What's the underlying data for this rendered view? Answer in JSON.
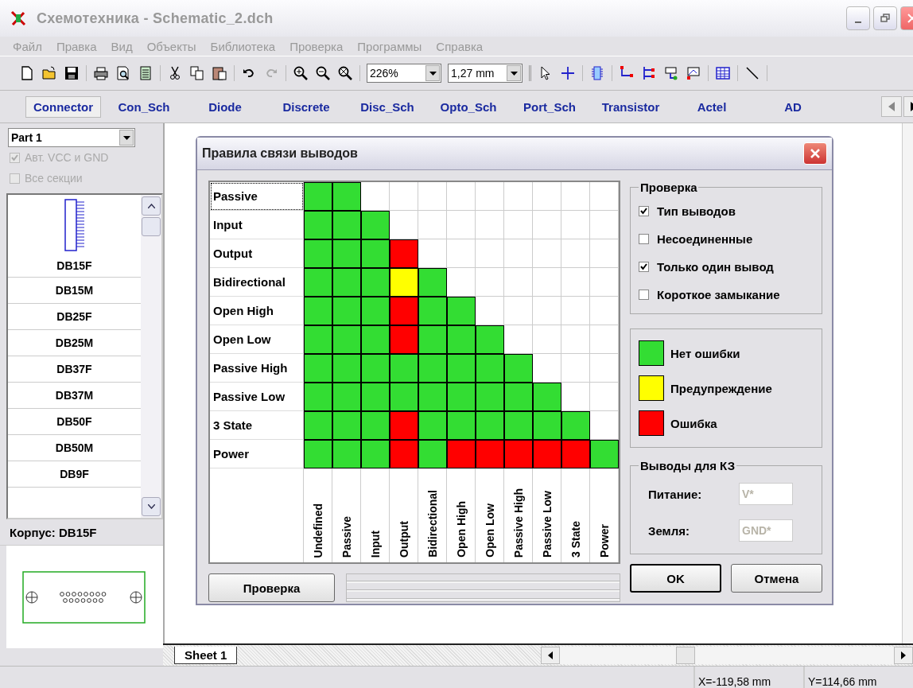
{
  "window": {
    "title": "Схемотехника - Schematic_2.dch"
  },
  "menu": [
    "Файл",
    "Правка",
    "Вид",
    "Объекты",
    "Библиотека",
    "Проверка",
    "Программы",
    "Справка"
  ],
  "toolbar": {
    "zoom": "226%",
    "grid": "1,27 mm"
  },
  "library_tabs": [
    {
      "label": "Connector",
      "selected": true
    },
    {
      "label": "Con_Sch",
      "selected": false
    },
    {
      "label": "Diode",
      "selected": false
    },
    {
      "label": "Discrete",
      "selected": false
    },
    {
      "label": "Disc_Sch",
      "selected": false
    },
    {
      "label": "Opto_Sch",
      "selected": false
    },
    {
      "label": "Port_Sch",
      "selected": false
    },
    {
      "label": "Transistor",
      "selected": false
    },
    {
      "label": "Actel",
      "selected": false
    },
    {
      "label": "AD",
      "selected": false
    }
  ],
  "sidebar": {
    "part": "Part 1",
    "options": [
      {
        "label": "Авт. VCC и GND",
        "checked": true,
        "disabled": true
      },
      {
        "label": "Все секции",
        "checked": false,
        "disabled": true
      }
    ],
    "components": [
      {
        "name": "DB15F",
        "selected": true
      },
      {
        "name": "DB15M",
        "selected": false
      },
      {
        "name": "DB25F",
        "selected": false
      },
      {
        "name": "DB25M",
        "selected": false
      },
      {
        "name": "DB37F",
        "selected": false
      },
      {
        "name": "DB37M",
        "selected": false
      },
      {
        "name": "DB50F",
        "selected": false
      },
      {
        "name": "DB50M",
        "selected": false
      },
      {
        "name": "DB9F",
        "selected": false
      }
    ],
    "package": "Корпус: DB15F"
  },
  "sheet_tabs": [
    {
      "label": "Sheet 1",
      "selected": true
    }
  ],
  "status_bar": {
    "x": "X=-119,58 mm",
    "y": "Y=114,66 mm"
  },
  "dialog": {
    "title": "Правила связи выводов",
    "rows": [
      {
        "label": "Passive",
        "focused": true,
        "cells": [
          {
            "color": "#33dd33"
          },
          {
            "color": "#33dd33"
          }
        ]
      },
      {
        "label": "Input",
        "focused": false,
        "cells": [
          {
            "color": "#33dd33"
          },
          {
            "color": "#33dd33"
          },
          {
            "color": "#33dd33"
          }
        ]
      },
      {
        "label": "Output",
        "focused": false,
        "cells": [
          {
            "color": "#33dd33"
          },
          {
            "color": "#33dd33"
          },
          {
            "color": "#33dd33"
          },
          {
            "color": "#ff0000"
          }
        ]
      },
      {
        "label": "Bidirectional",
        "focused": false,
        "cells": [
          {
            "color": "#33dd33"
          },
          {
            "color": "#33dd33"
          },
          {
            "color": "#33dd33"
          },
          {
            "color": "#ffff00"
          },
          {
            "color": "#33dd33"
          }
        ]
      },
      {
        "label": "Open High",
        "focused": false,
        "cells": [
          {
            "color": "#33dd33"
          },
          {
            "color": "#33dd33"
          },
          {
            "color": "#33dd33"
          },
          {
            "color": "#ff0000"
          },
          {
            "color": "#33dd33"
          },
          {
            "color": "#33dd33"
          }
        ]
      },
      {
        "label": "Open Low",
        "focused": false,
        "cells": [
          {
            "color": "#33dd33"
          },
          {
            "color": "#33dd33"
          },
          {
            "color": "#33dd33"
          },
          {
            "color": "#ff0000"
          },
          {
            "color": "#33dd33"
          },
          {
            "color": "#33dd33"
          },
          {
            "color": "#33dd33"
          }
        ]
      },
      {
        "label": "Passive High",
        "focused": false,
        "cells": [
          {
            "color": "#33dd33"
          },
          {
            "color": "#33dd33"
          },
          {
            "color": "#33dd33"
          },
          {
            "color": "#33dd33"
          },
          {
            "color": "#33dd33"
          },
          {
            "color": "#33dd33"
          },
          {
            "color": "#33dd33"
          },
          {
            "color": "#33dd33"
          }
        ]
      },
      {
        "label": "Passive Low",
        "focused": false,
        "cells": [
          {
            "color": "#33dd33"
          },
          {
            "color": "#33dd33"
          },
          {
            "color": "#33dd33"
          },
          {
            "color": "#33dd33"
          },
          {
            "color": "#33dd33"
          },
          {
            "color": "#33dd33"
          },
          {
            "color": "#33dd33"
          },
          {
            "color": "#33dd33"
          },
          {
            "color": "#33dd33"
          }
        ]
      },
      {
        "label": "3 State",
        "focused": false,
        "cells": [
          {
            "color": "#33dd33"
          },
          {
            "color": "#33dd33"
          },
          {
            "color": "#33dd33"
          },
          {
            "color": "#ff0000"
          },
          {
            "color": "#33dd33"
          },
          {
            "color": "#33dd33"
          },
          {
            "color": "#33dd33"
          },
          {
            "color": "#33dd33"
          },
          {
            "color": "#33dd33"
          },
          {
            "color": "#33dd33"
          }
        ]
      },
      {
        "label": "Power",
        "focused": false,
        "cells": [
          {
            "color": "#33dd33"
          },
          {
            "color": "#33dd33"
          },
          {
            "color": "#33dd33"
          },
          {
            "color": "#ff0000"
          },
          {
            "color": "#33dd33"
          },
          {
            "color": "#ff0000"
          },
          {
            "color": "#ff0000"
          },
          {
            "color": "#ff0000"
          },
          {
            "color": "#ff0000"
          },
          {
            "color": "#ff0000"
          },
          {
            "color": "#33dd33"
          }
        ]
      }
    ],
    "columns": [
      "Undefined",
      "Passive",
      "Input",
      "Output",
      "Bidirectional",
      "Open High",
      "Open Low",
      "Passive High",
      "Passive Low",
      "3 State",
      "Power"
    ],
    "check_group": {
      "title": "Проверка",
      "options": [
        {
          "label": "Тип выводов",
          "checked": true
        },
        {
          "label": "Несоединенные",
          "checked": false
        },
        {
          "label": "Только один вывод",
          "checked": true
        },
        {
          "label": "Короткое замыкание",
          "checked": false
        }
      ]
    },
    "legend": [
      {
        "color": "#33dd33",
        "label": "Нет ошибки"
      },
      {
        "color": "#ffff00",
        "label": "Предупреждение"
      },
      {
        "color": "#ff0000",
        "label": "Ошибка"
      }
    ],
    "short_group": {
      "title": "Выводы для КЗ",
      "fields": [
        {
          "label": "Питание:",
          "value": "V*",
          "disabled": true
        },
        {
          "label": "Земля:",
          "value": "GND*",
          "disabled": true
        }
      ]
    },
    "buttons": {
      "check": "Проверка",
      "ok": "OK",
      "cancel": "Отмена"
    }
  }
}
